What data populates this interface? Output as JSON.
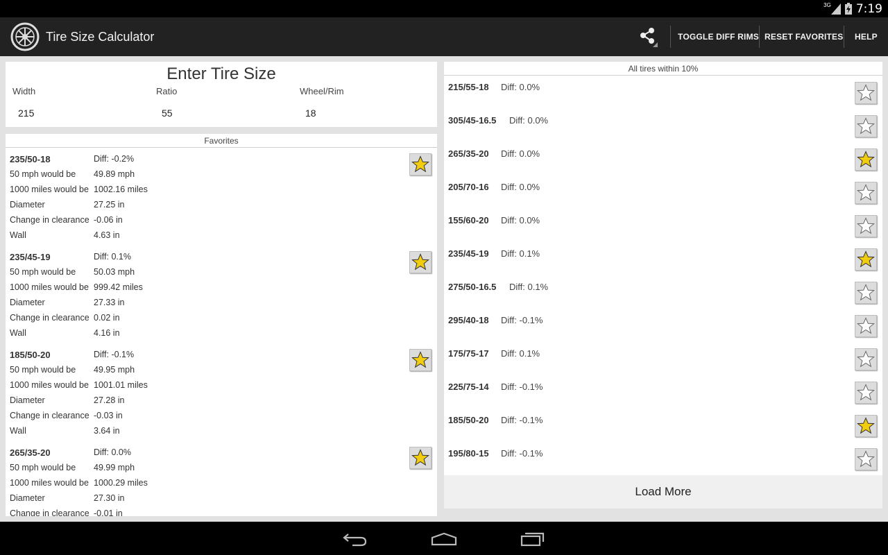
{
  "status_bar": {
    "network": "3G",
    "time": "7:19"
  },
  "action_bar": {
    "title": "Tire Size Calculator",
    "actions": {
      "toggle_diff_rims": "TOGGLE DIFF RIMS",
      "reset_favorites": "RESET FAVORITES",
      "help": "HELP"
    }
  },
  "enter": {
    "title": "Enter Tire Size",
    "width_label": "Width",
    "width_value": "215",
    "ratio_label": "Ratio",
    "ratio_value": "55",
    "rim_label": "Wheel/Rim",
    "rim_value": "18"
  },
  "favorites": {
    "header": "Favorites",
    "row_labels": {
      "speed": "50 mph would be",
      "distance": "1000 miles would be",
      "diameter": "Diameter",
      "clearance": "Change in clearance",
      "wall": "Wall"
    },
    "items": [
      {
        "size": "235/50-18",
        "diff": "Diff: -0.2%",
        "speed": "49.89 mph",
        "distance": "1002.16 miles",
        "diameter": "27.25 in",
        "clearance": "-0.06 in",
        "wall": "4.63 in"
      },
      {
        "size": "235/45-19",
        "diff": "Diff: 0.1%",
        "speed": "50.03 mph",
        "distance": "999.42 miles",
        "diameter": "27.33 in",
        "clearance": "0.02 in",
        "wall": "4.16 in"
      },
      {
        "size": "185/50-20",
        "diff": "Diff: -0.1%",
        "speed": "49.95 mph",
        "distance": "1001.01 miles",
        "diameter": "27.28 in",
        "clearance": "-0.03 in",
        "wall": "3.64 in"
      },
      {
        "size": "265/35-20",
        "diff": "Diff: 0.0%",
        "speed": "49.99 mph",
        "distance": "1000.29 miles",
        "diameter": "27.30 in",
        "clearance": "-0.01 in",
        "wall": ""
      }
    ]
  },
  "all_tires": {
    "header": "All tires within 10%",
    "items": [
      {
        "size": "215/55-18",
        "diff": "Diff: 0.0%",
        "favorite": false
      },
      {
        "size": "305/45-16.5",
        "diff": "Diff: 0.0%",
        "favorite": false
      },
      {
        "size": "265/35-20",
        "diff": "Diff: 0.0%",
        "favorite": true
      },
      {
        "size": "205/70-16",
        "diff": "Diff: 0.0%",
        "favorite": false
      },
      {
        "size": "155/60-20",
        "diff": "Diff: 0.0%",
        "favorite": false
      },
      {
        "size": "235/45-19",
        "diff": "Diff: 0.1%",
        "favorite": true
      },
      {
        "size": "275/50-16.5",
        "diff": "Diff: 0.1%",
        "favorite": false
      },
      {
        "size": "295/40-18",
        "diff": "Diff: -0.1%",
        "favorite": false
      },
      {
        "size": "175/75-17",
        "diff": "Diff: 0.1%",
        "favorite": false
      },
      {
        "size": "225/75-14",
        "diff": "Diff: -0.1%",
        "favorite": false
      },
      {
        "size": "185/50-20",
        "diff": "Diff: -0.1%",
        "favorite": true
      },
      {
        "size": "195/80-15",
        "diff": "Diff: -0.1%",
        "favorite": false
      }
    ],
    "load_more": "Load More"
  },
  "icons": {
    "logo": "tire-logo-icon",
    "share": "share-icon",
    "star_filled": "star-filled-icon",
    "star_empty": "star-outline-icon",
    "back": "back-icon",
    "home": "home-icon",
    "recents": "recents-icon"
  },
  "colors": {
    "star_fill": "#f2cc0f",
    "action_bar": "#222222",
    "background": "#e2e2e2"
  }
}
